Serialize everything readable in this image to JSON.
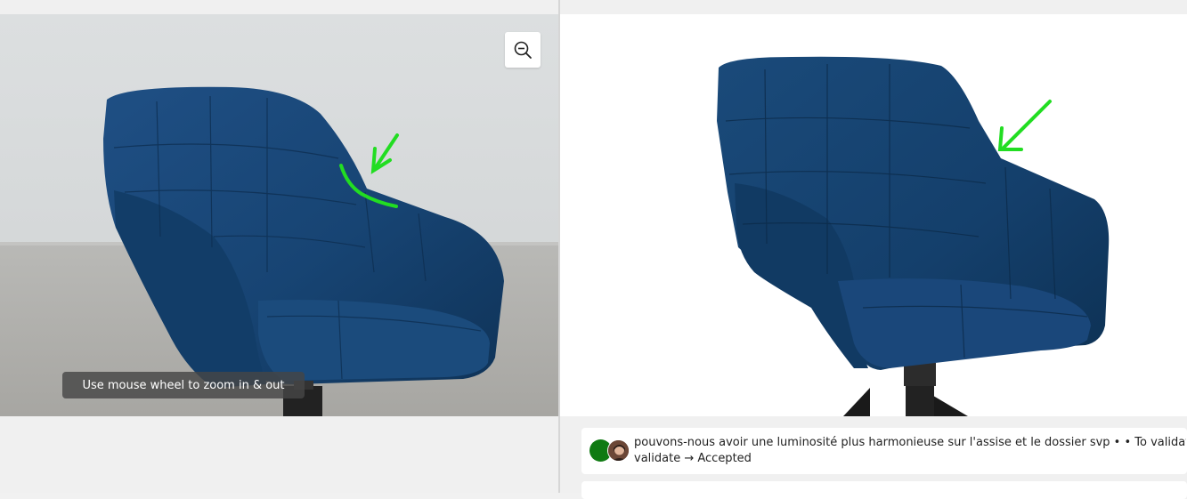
{
  "viewer": {
    "zoom_hint": "Use mouse wheel to zoom in & out",
    "zoom_icon": "zoom-out-icon",
    "annotation_color": "#22dd22"
  },
  "comments": [
    {
      "line1": "pouvons-nous avoir une luminosité plus harmonieuse sur l'assise et le dossier svp • • To validate",
      "line2": "validate → Accepted",
      "status_color": "#0f7a12"
    }
  ]
}
